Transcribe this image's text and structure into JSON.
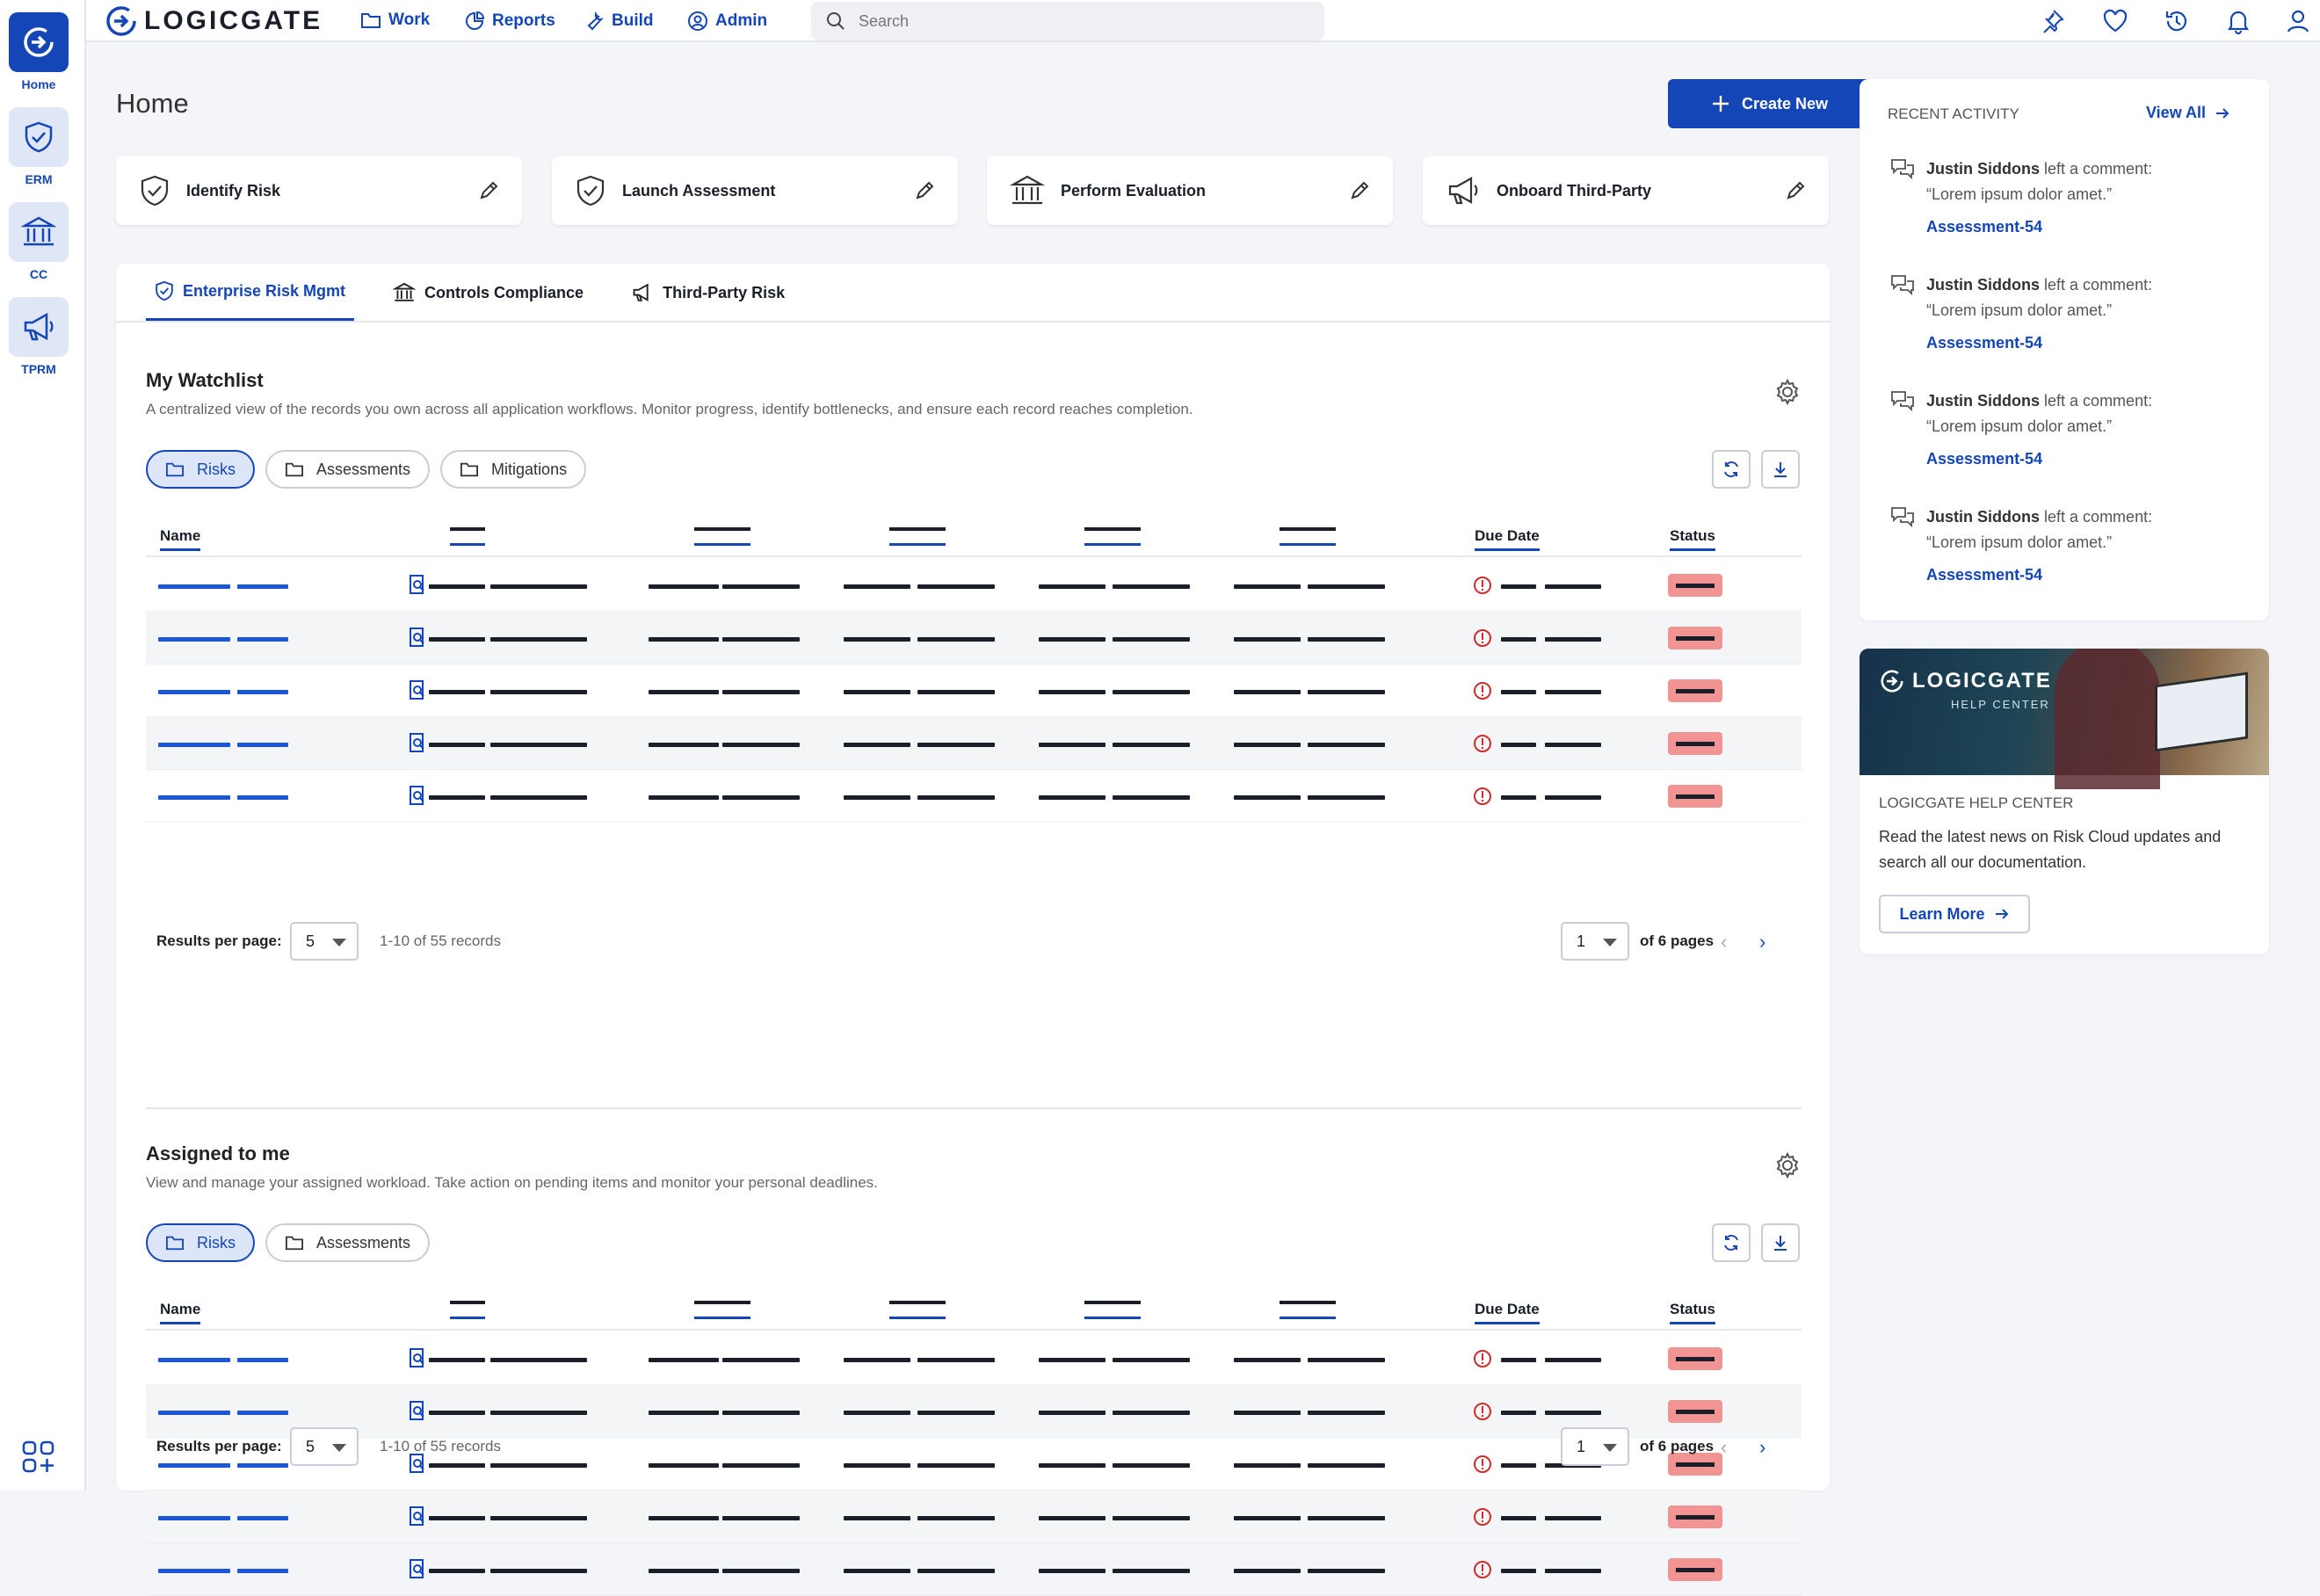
{
  "rail": {
    "items": [
      {
        "label": "Home",
        "icon": "logicgate-icon",
        "active": true
      },
      {
        "label": "ERM",
        "icon": "shield-icon"
      },
      {
        "label": "CC",
        "icon": "bank-icon"
      },
      {
        "label": "TPRM",
        "icon": "megaphone-icon"
      }
    ],
    "apps_icon": "apps-grid-icon"
  },
  "topbar": {
    "logo": "LOGICGATE",
    "nav": [
      {
        "label": "Work",
        "icon": "folder-icon"
      },
      {
        "label": "Reports",
        "icon": "chart-icon"
      },
      {
        "label": "Build",
        "icon": "wrench-icon"
      },
      {
        "label": "Admin",
        "icon": "user-circle-icon"
      }
    ],
    "search_placeholder": "Search",
    "icons": [
      "pin-icon",
      "heart-icon",
      "history-icon",
      "bell-icon",
      "user-icon"
    ]
  },
  "page": {
    "title": "Home",
    "create_label": "Create New"
  },
  "quick_actions": [
    {
      "label": "Identify Risk",
      "icon": "shield-icon"
    },
    {
      "label": "Launch Assessment",
      "icon": "shield-icon"
    },
    {
      "label": "Perform Evaluation",
      "icon": "bank-icon"
    },
    {
      "label": "Onboard Third-Party",
      "icon": "megaphone-icon"
    }
  ],
  "tabs": [
    {
      "label": "Enterprise Risk Mgmt",
      "active": true
    },
    {
      "label": "Controls Compliance"
    },
    {
      "label": "Third-Party Risk"
    }
  ],
  "watchlist": {
    "title": "My Watchlist",
    "description": "A centralized view of the records you own across all application workflows. Monitor progress, identify bottlenecks, and ensure each record reaches completion.",
    "pills": [
      {
        "label": "Risks",
        "active": true
      },
      {
        "label": "Assessments"
      },
      {
        "label": "Mitigations"
      }
    ],
    "columns": {
      "name": "Name",
      "due": "Due Date",
      "status": "Status"
    },
    "rows": 5,
    "per_page_label": "Results per page:",
    "per_page": "5",
    "records": "1-10 of 55 records",
    "page": "1",
    "pages": "of 6 pages"
  },
  "assigned": {
    "title": "Assigned to me",
    "description": "View and manage your assigned workload. Take action on pending items and monitor your personal deadlines.",
    "pills": [
      {
        "label": "Risks",
        "active": true
      },
      {
        "label": "Assessments"
      }
    ],
    "columns": {
      "name": "Name",
      "due": "Due Date",
      "status": "Status"
    },
    "rows": 5,
    "per_page_label": "Results per page:",
    "per_page": "5",
    "records": "1-10 of 55 records",
    "page": "1",
    "pages": "of 6 pages"
  },
  "activity": {
    "title": "RECENT ACTIVITY",
    "view_all": "View All",
    "items": [
      {
        "name": "Justin Siddons",
        "action": "left a comment:",
        "quote": "“Lorem ipsum dolor amet.”",
        "link": "Assessment-54"
      },
      {
        "name": "Justin Siddons",
        "action": "left a comment:",
        "quote": "“Lorem ipsum dolor amet.”",
        "link": "Assessment-54"
      },
      {
        "name": "Justin Siddons",
        "action": "left a comment:",
        "quote": "“Lorem ipsum dolor amet.”",
        "link": "Assessment-54"
      },
      {
        "name": "Justin Siddons",
        "action": "left a comment:",
        "quote": "“Lorem ipsum dolor amet.”",
        "link": "Assessment-54"
      }
    ]
  },
  "help": {
    "banner_logo": "LOGICGATE",
    "banner_sub": "HELP CENTER",
    "title": "LOGICGATE HELP CENTER",
    "text": "Read the latest news on Risk Cloud updates and search all our documentation.",
    "button": "Learn More"
  },
  "colors": {
    "brand": "#1446b8",
    "status": "#f29494",
    "alert": "#d12b2b"
  }
}
